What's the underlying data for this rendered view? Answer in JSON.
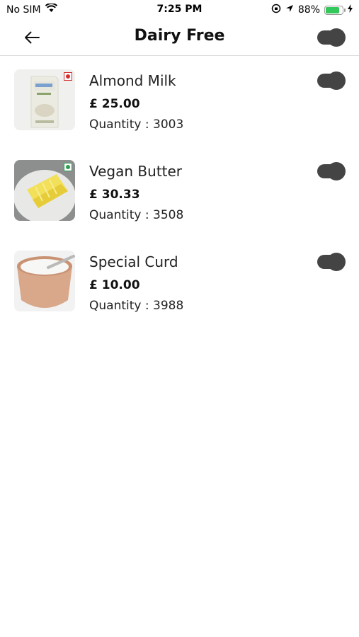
{
  "status_bar": {
    "carrier": "No SIM",
    "time": "7:25 PM",
    "battery": "88%",
    "battery_level": 0.88
  },
  "header": {
    "title": "Dairy Free",
    "back_icon": "arrow-left-icon"
  },
  "products": [
    {
      "name": "Almond Milk",
      "price": "£ 25.00",
      "quantity": "Quantity : 3003",
      "mark_color": "#d32f2f"
    },
    {
      "name": "Vegan Butter",
      "price": "£ 30.33",
      "quantity": "Quantity : 3508",
      "mark_color": "#2e9e4f"
    },
    {
      "name": "Special Curd",
      "price": "£ 10.00",
      "quantity": "Quantity : 3988",
      "mark_color": ""
    }
  ],
  "colors": {
    "toggle": "#444444",
    "divider": "#dcdcdc",
    "battery_green": "#34c759"
  }
}
